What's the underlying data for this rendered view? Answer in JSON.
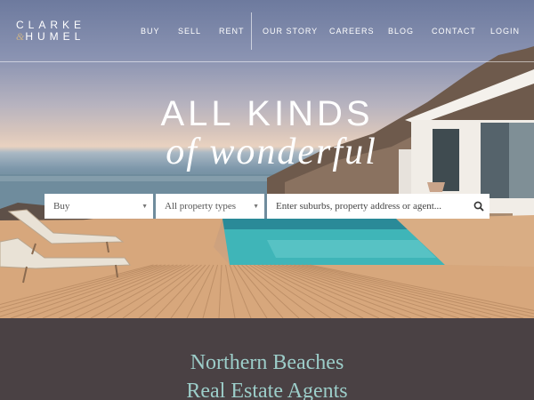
{
  "brand": {
    "logo_line1": "CLARKE",
    "logo_amp": "&",
    "logo_line2": "HUMEL"
  },
  "nav": {
    "items": [
      "BUY",
      "SELL",
      "RENT",
      "OUR STORY",
      "CAREERS",
      "BLOG",
      "CONTACT",
      "LOGIN"
    ]
  },
  "hero": {
    "headline_line1": "ALL KINDS",
    "headline_line2": "of wonderful"
  },
  "search": {
    "listing_type": "Buy",
    "property_type": "All property types",
    "query_placeholder": "Enter suburbs, property address or agent...",
    "search_icon": "magnifier-icon",
    "dropdown_icon": "chevron-down-icon"
  },
  "section": {
    "title_line1": "Northern Beaches",
    "title_line2": "Real Estate Agents"
  },
  "colors": {
    "section_bg": "#4a4144",
    "section_title": "#9ccdc9",
    "logo_accent": "#c9b28a"
  }
}
